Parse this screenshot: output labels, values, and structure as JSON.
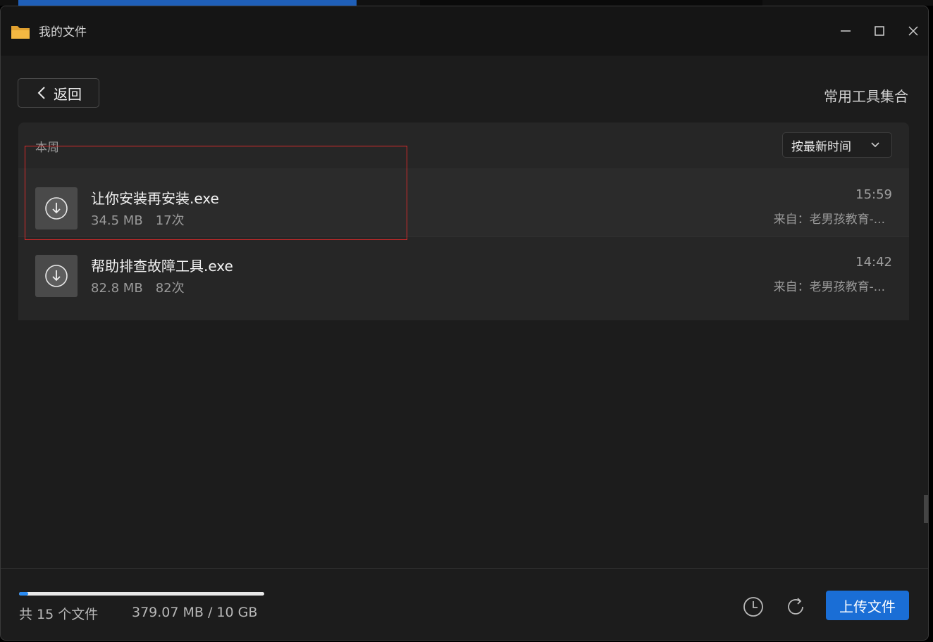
{
  "window": {
    "title": "我的文件"
  },
  "toolbar": {
    "back_label": "返回",
    "folder_title": "常用工具集合"
  },
  "list": {
    "section_label": "本周",
    "sort_label": "按最新时间",
    "files": [
      {
        "name": "让你安装再安装.exe",
        "size": "34.5 MB",
        "count": "17次",
        "time": "15:59",
        "source": "来自：老男孩教育-..."
      },
      {
        "name": "帮助排查故障工具.exe",
        "size": "82.8 MB",
        "count": "82次",
        "time": "14:42",
        "source": "来自：老男孩教育-..."
      }
    ]
  },
  "footer": {
    "file_count": "共 15 个文件",
    "storage_used": "379.07 MB / 10 GB",
    "storage_fraction": 0.037,
    "upload_label": "上传文件"
  },
  "colors": {
    "accent": "#1a6ed6",
    "highlight": "#d92a2a",
    "folder": "#f5b942"
  },
  "icons": [
    "folder-icon",
    "minimize-icon",
    "maximize-icon",
    "close-icon",
    "chevron-left-icon",
    "chevron-down-icon",
    "download-icon",
    "history-icon",
    "refresh-icon"
  ]
}
